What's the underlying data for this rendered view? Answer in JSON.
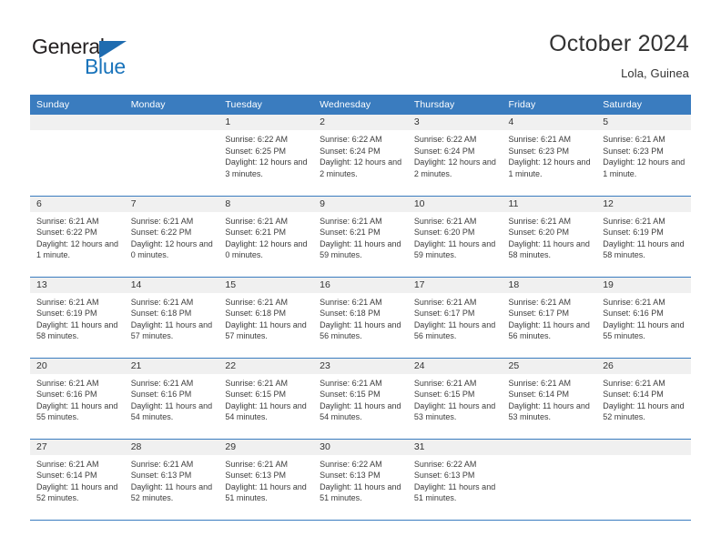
{
  "brand": {
    "name_top": "General",
    "name_bottom": "Blue",
    "accent_color": "#1a74bb",
    "triangle_color": "#1f6cb0"
  },
  "header": {
    "title": "October 2024",
    "subtitle": "Lola, Guinea"
  },
  "calendar": {
    "header_bg": "#3a7cbf",
    "daynum_bg": "#f0f0f0",
    "weekday_headers": [
      "Sunday",
      "Monday",
      "Tuesday",
      "Wednesday",
      "Thursday",
      "Friday",
      "Saturday"
    ],
    "weeks": [
      [
        {
          "day": "",
          "blank": true
        },
        {
          "day": "",
          "blank": true
        },
        {
          "day": "1",
          "sunrise": "Sunrise: 6:22 AM",
          "sunset": "Sunset: 6:25 PM",
          "daylight": "Daylight: 12 hours and 3 minutes."
        },
        {
          "day": "2",
          "sunrise": "Sunrise: 6:22 AM",
          "sunset": "Sunset: 6:24 PM",
          "daylight": "Daylight: 12 hours and 2 minutes."
        },
        {
          "day": "3",
          "sunrise": "Sunrise: 6:22 AM",
          "sunset": "Sunset: 6:24 PM",
          "daylight": "Daylight: 12 hours and 2 minutes."
        },
        {
          "day": "4",
          "sunrise": "Sunrise: 6:21 AM",
          "sunset": "Sunset: 6:23 PM",
          "daylight": "Daylight: 12 hours and 1 minute."
        },
        {
          "day": "5",
          "sunrise": "Sunrise: 6:21 AM",
          "sunset": "Sunset: 6:23 PM",
          "daylight": "Daylight: 12 hours and 1 minute."
        }
      ],
      [
        {
          "day": "6",
          "sunrise": "Sunrise: 6:21 AM",
          "sunset": "Sunset: 6:22 PM",
          "daylight": "Daylight: 12 hours and 1 minute."
        },
        {
          "day": "7",
          "sunrise": "Sunrise: 6:21 AM",
          "sunset": "Sunset: 6:22 PM",
          "daylight": "Daylight: 12 hours and 0 minutes."
        },
        {
          "day": "8",
          "sunrise": "Sunrise: 6:21 AM",
          "sunset": "Sunset: 6:21 PM",
          "daylight": "Daylight: 12 hours and 0 minutes."
        },
        {
          "day": "9",
          "sunrise": "Sunrise: 6:21 AM",
          "sunset": "Sunset: 6:21 PM",
          "daylight": "Daylight: 11 hours and 59 minutes."
        },
        {
          "day": "10",
          "sunrise": "Sunrise: 6:21 AM",
          "sunset": "Sunset: 6:20 PM",
          "daylight": "Daylight: 11 hours and 59 minutes."
        },
        {
          "day": "11",
          "sunrise": "Sunrise: 6:21 AM",
          "sunset": "Sunset: 6:20 PM",
          "daylight": "Daylight: 11 hours and 58 minutes."
        },
        {
          "day": "12",
          "sunrise": "Sunrise: 6:21 AM",
          "sunset": "Sunset: 6:19 PM",
          "daylight": "Daylight: 11 hours and 58 minutes."
        }
      ],
      [
        {
          "day": "13",
          "sunrise": "Sunrise: 6:21 AM",
          "sunset": "Sunset: 6:19 PM",
          "daylight": "Daylight: 11 hours and 58 minutes."
        },
        {
          "day": "14",
          "sunrise": "Sunrise: 6:21 AM",
          "sunset": "Sunset: 6:18 PM",
          "daylight": "Daylight: 11 hours and 57 minutes."
        },
        {
          "day": "15",
          "sunrise": "Sunrise: 6:21 AM",
          "sunset": "Sunset: 6:18 PM",
          "daylight": "Daylight: 11 hours and 57 minutes."
        },
        {
          "day": "16",
          "sunrise": "Sunrise: 6:21 AM",
          "sunset": "Sunset: 6:18 PM",
          "daylight": "Daylight: 11 hours and 56 minutes."
        },
        {
          "day": "17",
          "sunrise": "Sunrise: 6:21 AM",
          "sunset": "Sunset: 6:17 PM",
          "daylight": "Daylight: 11 hours and 56 minutes."
        },
        {
          "day": "18",
          "sunrise": "Sunrise: 6:21 AM",
          "sunset": "Sunset: 6:17 PM",
          "daylight": "Daylight: 11 hours and 56 minutes."
        },
        {
          "day": "19",
          "sunrise": "Sunrise: 6:21 AM",
          "sunset": "Sunset: 6:16 PM",
          "daylight": "Daylight: 11 hours and 55 minutes."
        }
      ],
      [
        {
          "day": "20",
          "sunrise": "Sunrise: 6:21 AM",
          "sunset": "Sunset: 6:16 PM",
          "daylight": "Daylight: 11 hours and 55 minutes."
        },
        {
          "day": "21",
          "sunrise": "Sunrise: 6:21 AM",
          "sunset": "Sunset: 6:16 PM",
          "daylight": "Daylight: 11 hours and 54 minutes."
        },
        {
          "day": "22",
          "sunrise": "Sunrise: 6:21 AM",
          "sunset": "Sunset: 6:15 PM",
          "daylight": "Daylight: 11 hours and 54 minutes."
        },
        {
          "day": "23",
          "sunrise": "Sunrise: 6:21 AM",
          "sunset": "Sunset: 6:15 PM",
          "daylight": "Daylight: 11 hours and 54 minutes."
        },
        {
          "day": "24",
          "sunrise": "Sunrise: 6:21 AM",
          "sunset": "Sunset: 6:15 PM",
          "daylight": "Daylight: 11 hours and 53 minutes."
        },
        {
          "day": "25",
          "sunrise": "Sunrise: 6:21 AM",
          "sunset": "Sunset: 6:14 PM",
          "daylight": "Daylight: 11 hours and 53 minutes."
        },
        {
          "day": "26",
          "sunrise": "Sunrise: 6:21 AM",
          "sunset": "Sunset: 6:14 PM",
          "daylight": "Daylight: 11 hours and 52 minutes."
        }
      ],
      [
        {
          "day": "27",
          "sunrise": "Sunrise: 6:21 AM",
          "sunset": "Sunset: 6:14 PM",
          "daylight": "Daylight: 11 hours and 52 minutes."
        },
        {
          "day": "28",
          "sunrise": "Sunrise: 6:21 AM",
          "sunset": "Sunset: 6:13 PM",
          "daylight": "Daylight: 11 hours and 52 minutes."
        },
        {
          "day": "29",
          "sunrise": "Sunrise: 6:21 AM",
          "sunset": "Sunset: 6:13 PM",
          "daylight": "Daylight: 11 hours and 51 minutes."
        },
        {
          "day": "30",
          "sunrise": "Sunrise: 6:22 AM",
          "sunset": "Sunset: 6:13 PM",
          "daylight": "Daylight: 11 hours and 51 minutes."
        },
        {
          "day": "31",
          "sunrise": "Sunrise: 6:22 AM",
          "sunset": "Sunset: 6:13 PM",
          "daylight": "Daylight: 11 hours and 51 minutes."
        },
        {
          "day": "",
          "blank": true
        },
        {
          "day": "",
          "blank": true
        }
      ]
    ]
  }
}
